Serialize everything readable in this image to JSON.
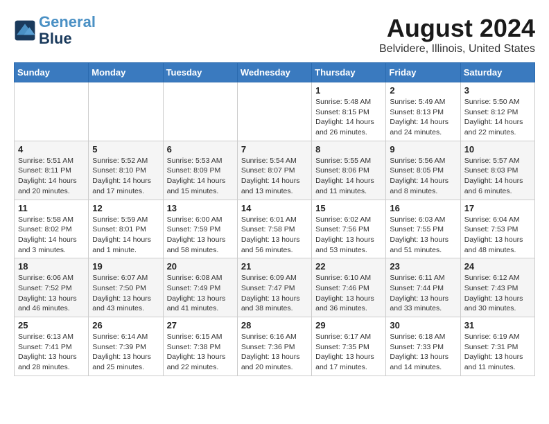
{
  "header": {
    "logo_line1": "General",
    "logo_line2": "Blue",
    "main_title": "August 2024",
    "subtitle": "Belvidere, Illinois, United States"
  },
  "weekdays": [
    "Sunday",
    "Monday",
    "Tuesday",
    "Wednesday",
    "Thursday",
    "Friday",
    "Saturday"
  ],
  "weeks": [
    [
      {
        "day": "",
        "info": ""
      },
      {
        "day": "",
        "info": ""
      },
      {
        "day": "",
        "info": ""
      },
      {
        "day": "",
        "info": ""
      },
      {
        "day": "1",
        "info": "Sunrise: 5:48 AM\nSunset: 8:15 PM\nDaylight: 14 hours\nand 26 minutes."
      },
      {
        "day": "2",
        "info": "Sunrise: 5:49 AM\nSunset: 8:13 PM\nDaylight: 14 hours\nand 24 minutes."
      },
      {
        "day": "3",
        "info": "Sunrise: 5:50 AM\nSunset: 8:12 PM\nDaylight: 14 hours\nand 22 minutes."
      }
    ],
    [
      {
        "day": "4",
        "info": "Sunrise: 5:51 AM\nSunset: 8:11 PM\nDaylight: 14 hours\nand 20 minutes."
      },
      {
        "day": "5",
        "info": "Sunrise: 5:52 AM\nSunset: 8:10 PM\nDaylight: 14 hours\nand 17 minutes."
      },
      {
        "day": "6",
        "info": "Sunrise: 5:53 AM\nSunset: 8:09 PM\nDaylight: 14 hours\nand 15 minutes."
      },
      {
        "day": "7",
        "info": "Sunrise: 5:54 AM\nSunset: 8:07 PM\nDaylight: 14 hours\nand 13 minutes."
      },
      {
        "day": "8",
        "info": "Sunrise: 5:55 AM\nSunset: 8:06 PM\nDaylight: 14 hours\nand 11 minutes."
      },
      {
        "day": "9",
        "info": "Sunrise: 5:56 AM\nSunset: 8:05 PM\nDaylight: 14 hours\nand 8 minutes."
      },
      {
        "day": "10",
        "info": "Sunrise: 5:57 AM\nSunset: 8:03 PM\nDaylight: 14 hours\nand 6 minutes."
      }
    ],
    [
      {
        "day": "11",
        "info": "Sunrise: 5:58 AM\nSunset: 8:02 PM\nDaylight: 14 hours\nand 3 minutes."
      },
      {
        "day": "12",
        "info": "Sunrise: 5:59 AM\nSunset: 8:01 PM\nDaylight: 14 hours\nand 1 minute."
      },
      {
        "day": "13",
        "info": "Sunrise: 6:00 AM\nSunset: 7:59 PM\nDaylight: 13 hours\nand 58 minutes."
      },
      {
        "day": "14",
        "info": "Sunrise: 6:01 AM\nSunset: 7:58 PM\nDaylight: 13 hours\nand 56 minutes."
      },
      {
        "day": "15",
        "info": "Sunrise: 6:02 AM\nSunset: 7:56 PM\nDaylight: 13 hours\nand 53 minutes."
      },
      {
        "day": "16",
        "info": "Sunrise: 6:03 AM\nSunset: 7:55 PM\nDaylight: 13 hours\nand 51 minutes."
      },
      {
        "day": "17",
        "info": "Sunrise: 6:04 AM\nSunset: 7:53 PM\nDaylight: 13 hours\nand 48 minutes."
      }
    ],
    [
      {
        "day": "18",
        "info": "Sunrise: 6:06 AM\nSunset: 7:52 PM\nDaylight: 13 hours\nand 46 minutes."
      },
      {
        "day": "19",
        "info": "Sunrise: 6:07 AM\nSunset: 7:50 PM\nDaylight: 13 hours\nand 43 minutes."
      },
      {
        "day": "20",
        "info": "Sunrise: 6:08 AM\nSunset: 7:49 PM\nDaylight: 13 hours\nand 41 minutes."
      },
      {
        "day": "21",
        "info": "Sunrise: 6:09 AM\nSunset: 7:47 PM\nDaylight: 13 hours\nand 38 minutes."
      },
      {
        "day": "22",
        "info": "Sunrise: 6:10 AM\nSunset: 7:46 PM\nDaylight: 13 hours\nand 36 minutes."
      },
      {
        "day": "23",
        "info": "Sunrise: 6:11 AM\nSunset: 7:44 PM\nDaylight: 13 hours\nand 33 minutes."
      },
      {
        "day": "24",
        "info": "Sunrise: 6:12 AM\nSunset: 7:43 PM\nDaylight: 13 hours\nand 30 minutes."
      }
    ],
    [
      {
        "day": "25",
        "info": "Sunrise: 6:13 AM\nSunset: 7:41 PM\nDaylight: 13 hours\nand 28 minutes."
      },
      {
        "day": "26",
        "info": "Sunrise: 6:14 AM\nSunset: 7:39 PM\nDaylight: 13 hours\nand 25 minutes."
      },
      {
        "day": "27",
        "info": "Sunrise: 6:15 AM\nSunset: 7:38 PM\nDaylight: 13 hours\nand 22 minutes."
      },
      {
        "day": "28",
        "info": "Sunrise: 6:16 AM\nSunset: 7:36 PM\nDaylight: 13 hours\nand 20 minutes."
      },
      {
        "day": "29",
        "info": "Sunrise: 6:17 AM\nSunset: 7:35 PM\nDaylight: 13 hours\nand 17 minutes."
      },
      {
        "day": "30",
        "info": "Sunrise: 6:18 AM\nSunset: 7:33 PM\nDaylight: 13 hours\nand 14 minutes."
      },
      {
        "day": "31",
        "info": "Sunrise: 6:19 AM\nSunset: 7:31 PM\nDaylight: 13 hours\nand 11 minutes."
      }
    ]
  ]
}
